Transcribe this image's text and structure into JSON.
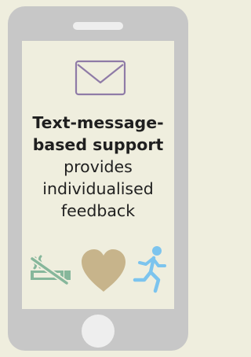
{
  "phone": {
    "screen": {
      "icon_top": "envelope-icon",
      "message": {
        "bold_line_1": "Text-message-",
        "bold_line_2": "based support",
        "line_3": "provides",
        "line_4": "individualised",
        "line_5": "feedback"
      },
      "bottom_icons": [
        "no-smoking-icon",
        "heart-icon",
        "running-person-icon"
      ]
    }
  },
  "colors": {
    "background": "#efeede",
    "phone_body": "#c7c7c7",
    "envelope": "#8f7ba7",
    "no_smoking": "#86b79b",
    "heart": "#c7b48b",
    "running": "#7cc4ee",
    "text": "#1f1f1f"
  }
}
